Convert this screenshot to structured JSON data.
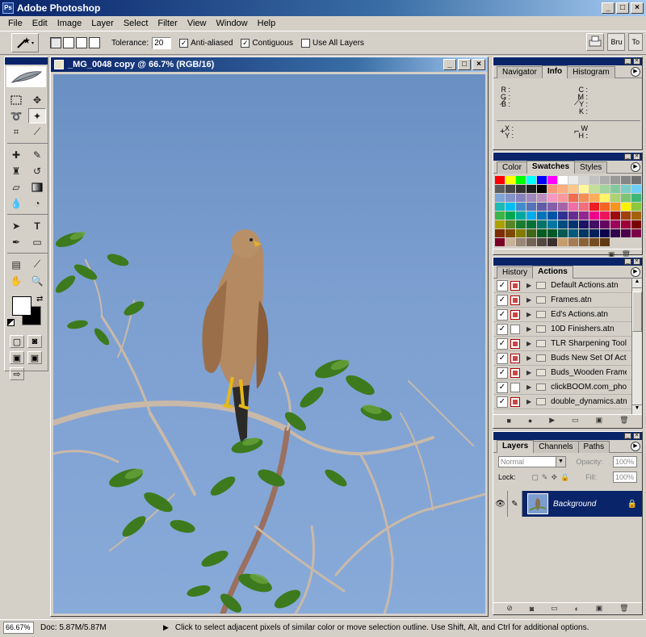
{
  "app": {
    "title": "Adobe Photoshop",
    "icon": "ps-icon"
  },
  "menu": [
    "File",
    "Edit",
    "Image",
    "Layer",
    "Select",
    "Filter",
    "View",
    "Window",
    "Help"
  ],
  "options": {
    "tolerance_label": "Tolerance:",
    "tolerance_value": "20",
    "anti_aliased_label": "Anti-aliased",
    "anti_aliased_checked": true,
    "contiguous_label": "Contiguous",
    "contiguous_checked": true,
    "use_all_layers_label": "Use All Layers",
    "use_all_layers_checked": false,
    "brush_tab": "Bru",
    "tool_tab": "To"
  },
  "document": {
    "title": "_MG_0048 copy @ 66.7% (RGB/16)"
  },
  "info_panel": {
    "tabs": [
      "Navigator",
      "Info",
      "Histogram"
    ],
    "active_tab": "Info",
    "rgb": [
      "R :",
      "G :",
      "B :"
    ],
    "cmyk": [
      "C :",
      "M :",
      "Y :",
      "K :"
    ],
    "xy": [
      "X :",
      "Y :"
    ],
    "wh": [
      "W :",
      "H :"
    ]
  },
  "swatches_panel": {
    "tabs": [
      "Color",
      "Swatches",
      "Styles"
    ],
    "active_tab": "Swatches",
    "colors": [
      "#ff0000",
      "#ffff00",
      "#00ff00",
      "#00ffff",
      "#0000ff",
      "#ff00ff",
      "#ffffff",
      "#ebebeb",
      "#d6d6d6",
      "#c2c2c2",
      "#adadad",
      "#999999",
      "#858585",
      "#707070",
      "#5c5c5c",
      "#474747",
      "#333333",
      "#1f1f1f",
      "#000000",
      "#f7977a",
      "#f9ad81",
      "#fdc68a",
      "#fff79a",
      "#c4df9b",
      "#a2d39c",
      "#82ca9d",
      "#7bcdc8",
      "#6ecff6",
      "#7ea7d8",
      "#8493ca",
      "#8882be",
      "#a187be",
      "#bc8dbf",
      "#f49ac2",
      "#f6989d",
      "#f26c4f",
      "#f68e55",
      "#fbaf5c",
      "#fff467",
      "#acd372",
      "#7cc576",
      "#3bb878",
      "#1abbb4",
      "#00bff3",
      "#438ccb",
      "#5574b9",
      "#605ca8",
      "#855fa8",
      "#a763a8",
      "#f06ea9",
      "#f26d7d",
      "#ed1c24",
      "#f26522",
      "#f7941d",
      "#fff200",
      "#8dc73f",
      "#39b54a",
      "#00a651",
      "#00a99d",
      "#00aeef",
      "#0072bc",
      "#0054a6",
      "#2e3192",
      "#662d91",
      "#92278f",
      "#ec008c",
      "#ed145b",
      "#9e0b0f",
      "#a0410d",
      "#a36209",
      "#aba000",
      "#598527",
      "#1a7b30",
      "#007236",
      "#00746b",
      "#0076a3",
      "#004b80",
      "#003471",
      "#1b1464",
      "#440e62",
      "#630460",
      "#9e005d",
      "#9e0039",
      "#790000",
      "#7b2e00",
      "#7d4900",
      "#827b00",
      "#406618",
      "#005e20",
      "#005826",
      "#005952",
      "#005b7f",
      "#003663",
      "#002157",
      "#0d004c",
      "#32004b",
      "#4b0049",
      "#7b0046",
      "#7a0026",
      "#c7b299",
      "#998675",
      "#736357",
      "#534741",
      "#37302d",
      "#c69c6d",
      "#a67c52",
      "#8c6239",
      "#754c24",
      "#603913",
      "#d4d0c8",
      "#d4d0c8",
      "#d4d0c8"
    ]
  },
  "actions_panel": {
    "tabs": [
      "History",
      "Actions"
    ],
    "active_tab": "Actions",
    "items": [
      {
        "label": "Default Actions.atn",
        "dialog": true
      },
      {
        "label": "Frames.atn",
        "dialog": true
      },
      {
        "label": "Ed's Actions.atn",
        "dialog": true
      },
      {
        "label": "10D Finishers.atn",
        "dialog": false
      },
      {
        "label": "TLR Sharpening Tool...",
        "dialog": true
      },
      {
        "label": "Buds New Set Of Acti...",
        "dialog": true
      },
      {
        "label": "Buds_Wooden Frame...",
        "dialog": true
      },
      {
        "label": "clickBOOM.com_pho...",
        "dialog": false
      },
      {
        "label": "double_dynamics.atn",
        "dialog": true
      }
    ]
  },
  "layers_panel": {
    "tabs": [
      "Layers",
      "Channels",
      "Paths"
    ],
    "active_tab": "Layers",
    "blend_mode": "Normal",
    "opacity_label": "Opacity:",
    "opacity_value": "100%",
    "lock_label": "Lock:",
    "fill_label": "Fill:",
    "fill_value": "100%",
    "layers": [
      {
        "name": "Background"
      }
    ]
  },
  "status": {
    "zoom": "66.67%",
    "doc_size": "Doc: 5.87M/5.87M",
    "hint": "Click to select adjacent pixels of similar color or move selection outline.  Use Shift, Alt, and Ctrl for additional options."
  }
}
